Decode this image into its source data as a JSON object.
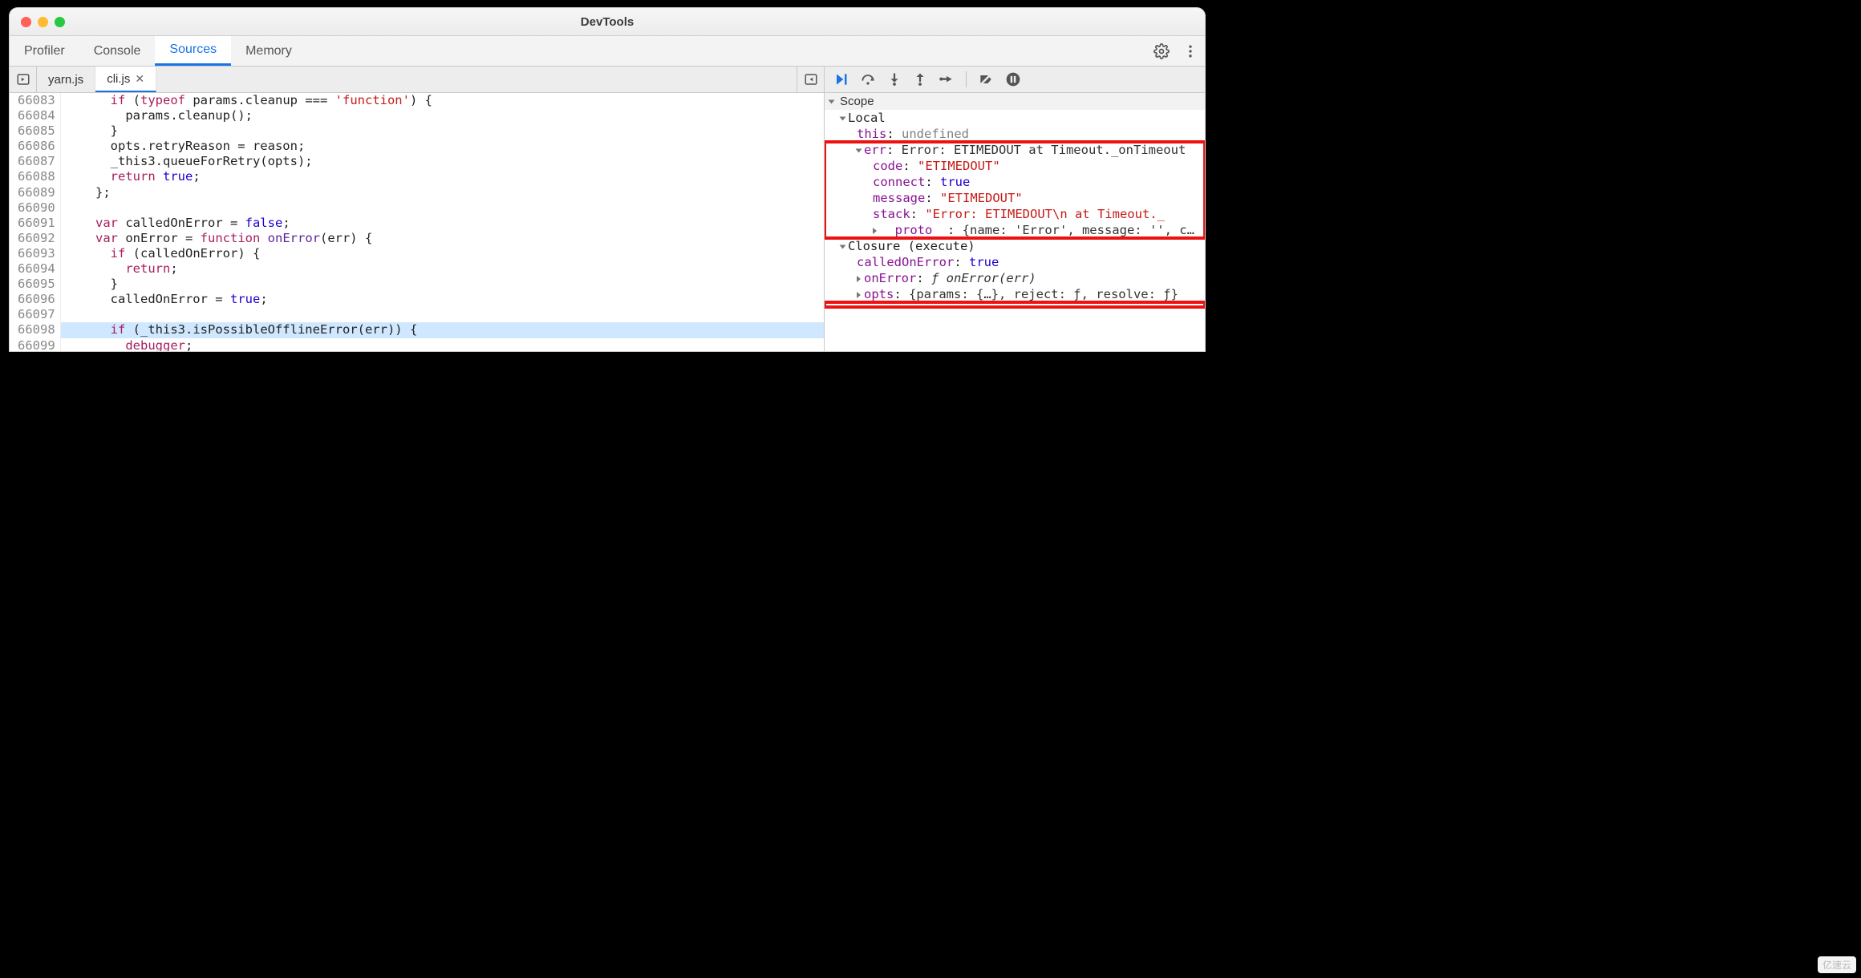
{
  "window": {
    "title": "DevTools"
  },
  "tabs": {
    "profiler": "Profiler",
    "console": "Console",
    "sources": "Sources",
    "memory": "Memory"
  },
  "files": {
    "yarn": "yarn.js",
    "cli": "cli.js"
  },
  "gutter_start": 66083,
  "code_lines": [
    {
      "n": 66083,
      "html": "      <span class='kw'>if</span> (<span class='kw'>typeof</span> params.cleanup === <span class='str'>'function'</span>) {"
    },
    {
      "n": 66084,
      "html": "        params.cleanup();"
    },
    {
      "n": 66085,
      "html": "      }"
    },
    {
      "n": 66086,
      "html": "      opts.retryReason = reason;"
    },
    {
      "n": 66087,
      "html": "      _this3.queueForRetry(opts);"
    },
    {
      "n": 66088,
      "html": "      <span class='kw'>return</span> <span class='bool'>true</span>;"
    },
    {
      "n": 66089,
      "html": "    };"
    },
    {
      "n": 66090,
      "html": ""
    },
    {
      "n": 66091,
      "html": "    <span class='kw'>var</span> calledOnError = <span class='bool'>false</span>;"
    },
    {
      "n": 66092,
      "html": "    <span class='kw'>var</span> onError = <span class='kw'>function</span> <span class='fn'>onError</span>(err) {"
    },
    {
      "n": 66093,
      "html": "      <span class='kw'>if</span> (calledOnError) {"
    },
    {
      "n": 66094,
      "html": "        <span class='kw'>return</span>;"
    },
    {
      "n": 66095,
      "html": "      }"
    },
    {
      "n": 66096,
      "html": "      calledOnError = <span class='bool'>true</span>;"
    },
    {
      "n": 66097,
      "html": ""
    },
    {
      "n": 66098,
      "html": "      <span class='kw'>if</span> (_this3.isPossibleOfflineError(err)) {",
      "hl": true
    },
    {
      "n": 66099,
      "html": "        <span class='kw'>debugger</span>;"
    }
  ],
  "scope": {
    "header": "Scope",
    "local": "Local",
    "this_label": "this",
    "this_value": "undefined",
    "err_label": "err",
    "err_value": "Error: ETIMEDOUT at Timeout._onTimeout",
    "code_label": "code",
    "code_value": "\"ETIMEDOUT\"",
    "connect_label": "connect",
    "connect_value": "true",
    "message_label": "message",
    "message_value": "\"ETIMEDOUT\"",
    "stack_label": "stack",
    "stack_value": "\"Error: ETIMEDOUT\\n    at Timeout._",
    "proto_label": "__proto__",
    "proto_value": "{name: 'Error', message: '', c…",
    "closure": "Closure (execute)",
    "calledOnError_label": "calledOnError",
    "calledOnError_value": "true",
    "onError_label": "onError",
    "onError_value": "ƒ onError(err)",
    "opts_label": "opts",
    "opts_value": "{params: {…}, reject: ƒ, resolve: ƒ}"
  },
  "watermark": "亿速云"
}
